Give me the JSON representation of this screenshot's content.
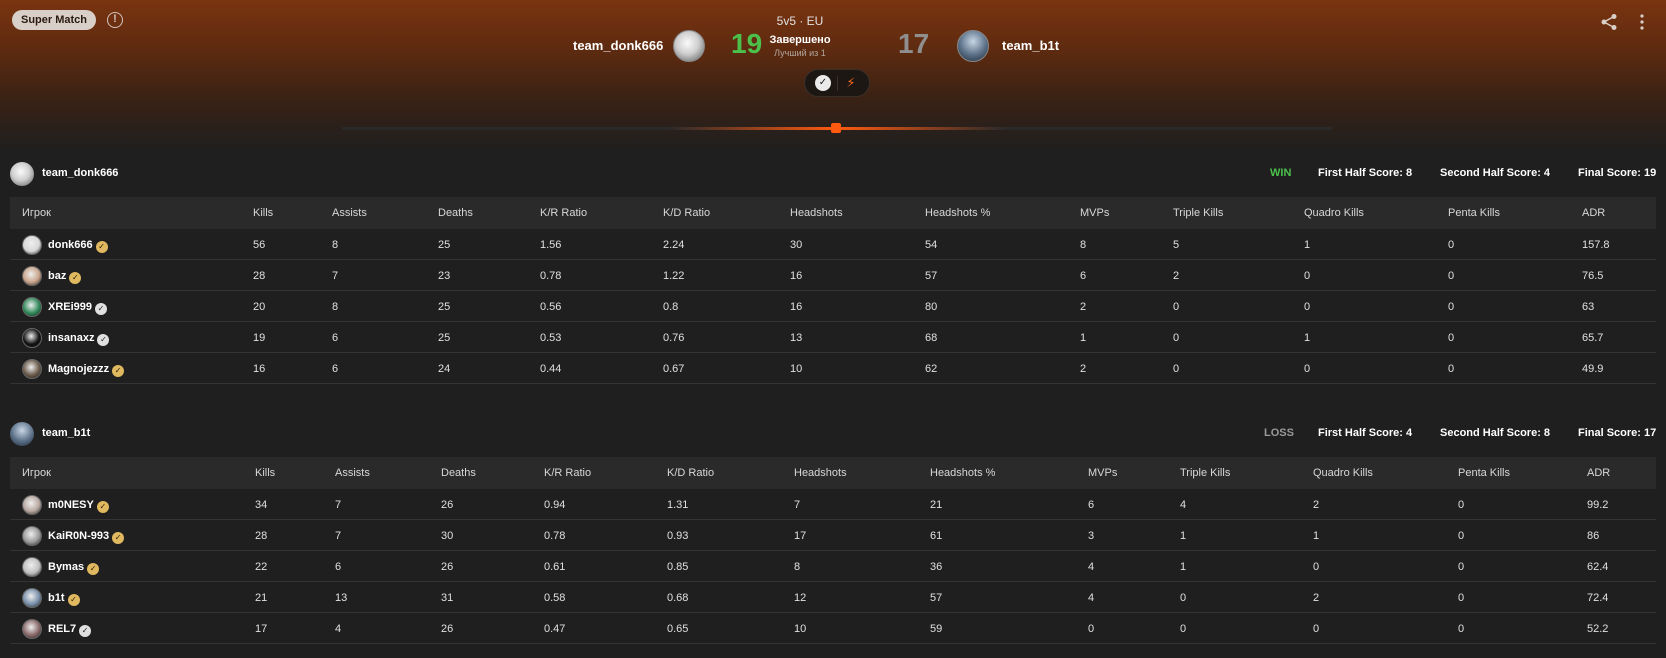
{
  "match": {
    "badge": "Super Match",
    "mode": "5v5 · EU",
    "status": "Завершено",
    "best_of": "Лучший из 1",
    "team1": {
      "name": "team_donk666",
      "score": "19"
    },
    "team2": {
      "name": "team_b1t",
      "score": "17"
    },
    "colors": {
      "accent": "#ff5a10",
      "win": "#4bc14b",
      "loss": "#9a9a9a"
    }
  },
  "columns": [
    "Игрок",
    "Kills",
    "Assists",
    "Deaths",
    "K/R Ratio",
    "K/D Ratio",
    "Headshots",
    "Headshots %",
    "MVPs",
    "Triple Kills",
    "Quadro Kills",
    "Penta Kills",
    "ADR"
  ],
  "teams": [
    {
      "name": "team_donk666",
      "result": "WIN",
      "first_half": "First Half Score: 8",
      "second_half": "Second Half Score: 4",
      "final": "Final Score: 19",
      "players": [
        {
          "name": "donk666",
          "badge": "gold",
          "avatar_color": "#d8d8d8",
          "stats": [
            "56",
            "8",
            "25",
            "1.56",
            "2.24",
            "30",
            "54",
            "8",
            "5",
            "1",
            "0",
            "157.8"
          ]
        },
        {
          "name": "baz",
          "badge": "gold",
          "avatar_color": "#c9a48a",
          "stats": [
            "28",
            "7",
            "23",
            "0.78",
            "1.22",
            "16",
            "57",
            "6",
            "2",
            "0",
            "0",
            "76.5"
          ]
        },
        {
          "name": "XREi999",
          "badge": "white",
          "avatar_color": "#2f8a5a",
          "stats": [
            "20",
            "8",
            "25",
            "0.56",
            "0.8",
            "16",
            "80",
            "2",
            "0",
            "0",
            "0",
            "63"
          ]
        },
        {
          "name": "insanaxz",
          "badge": "white",
          "avatar_color": "#111111",
          "stats": [
            "19",
            "6",
            "25",
            "0.53",
            "0.76",
            "13",
            "68",
            "1",
            "0",
            "1",
            "0",
            "65.7"
          ]
        },
        {
          "name": "Magnojezzz",
          "badge": "gold",
          "avatar_color": "#6a5a4a",
          "stats": [
            "16",
            "6",
            "24",
            "0.44",
            "0.67",
            "10",
            "62",
            "2",
            "0",
            "0",
            "0",
            "49.9"
          ]
        }
      ]
    },
    {
      "name": "team_b1t",
      "result": "LOSS",
      "first_half": "First Half Score: 4",
      "second_half": "Second Half Score: 8",
      "final": "Final Score: 17",
      "players": [
        {
          "name": "m0NESY",
          "badge": "gold",
          "avatar_color": "#b8a8a0",
          "stats": [
            "34",
            "7",
            "26",
            "0.94",
            "1.31",
            "7",
            "21",
            "6",
            "4",
            "2",
            "0",
            "99.2"
          ]
        },
        {
          "name": "KaiR0N-993",
          "badge": "gold",
          "avatar_color": "#9a9a9a",
          "stats": [
            "28",
            "7",
            "30",
            "0.78",
            "0.93",
            "17",
            "61",
            "3",
            "1",
            "1",
            "0",
            "86"
          ]
        },
        {
          "name": "Bymas",
          "badge": "gold",
          "avatar_color": "#c0c0c0",
          "stats": [
            "22",
            "6",
            "26",
            "0.61",
            "0.85",
            "8",
            "36",
            "4",
            "1",
            "0",
            "0",
            "62.4"
          ]
        },
        {
          "name": "b1t",
          "badge": "gold",
          "avatar_color": "#7890aa",
          "stats": [
            "21",
            "13",
            "31",
            "0.58",
            "0.68",
            "12",
            "57",
            "4",
            "0",
            "2",
            "0",
            "72.4"
          ]
        },
        {
          "name": "REL7",
          "badge": "white",
          "avatar_color": "#8a6a6a",
          "stats": [
            "17",
            "4",
            "26",
            "0.47",
            "0.65",
            "10",
            "59",
            "0",
            "0",
            "0",
            "0",
            "52.2"
          ]
        }
      ]
    }
  ]
}
